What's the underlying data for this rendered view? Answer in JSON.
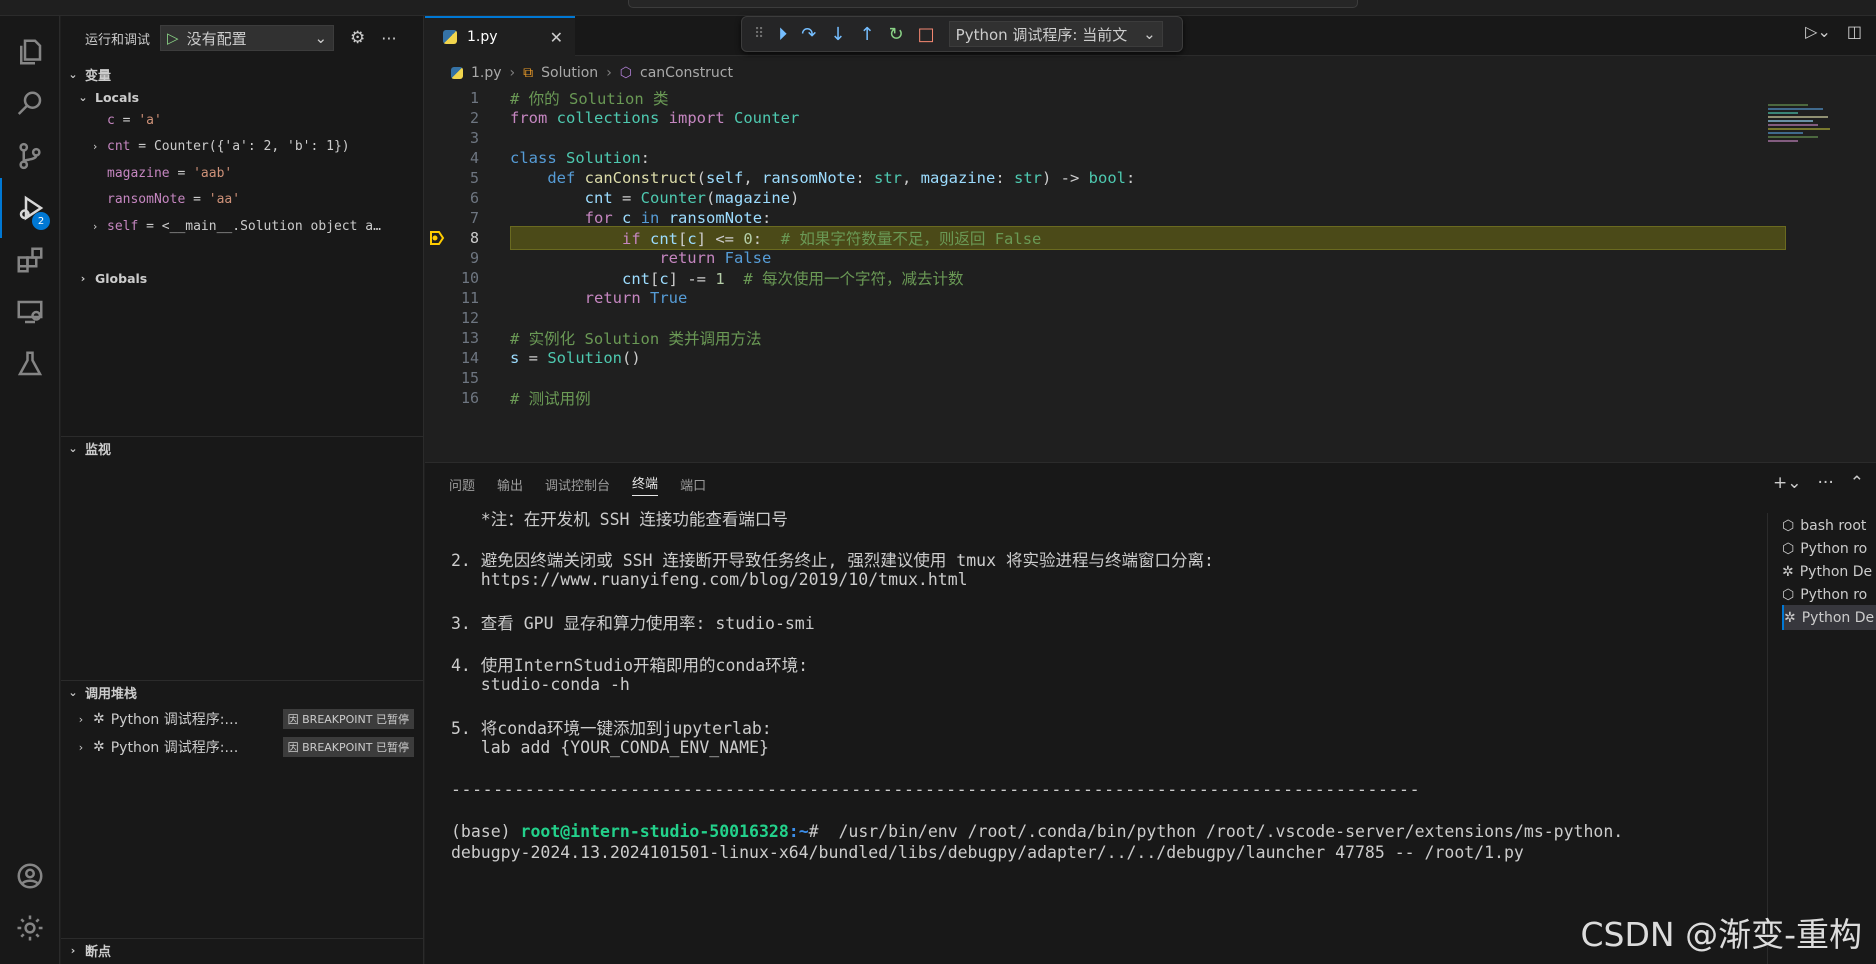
{
  "activity_bar": {
    "debug_badge": "2",
    "icons": [
      "files-icon",
      "search-icon",
      "source-control-icon",
      "run-debug-icon",
      "extensions-icon",
      "remote-explorer-icon",
      "testing-icon",
      "account-icon",
      "settings-gear-icon"
    ]
  },
  "sidebar": {
    "run_debug_label": "运行和调试",
    "config_value": "没有配置",
    "variables_title": "变量",
    "locals_title": "Locals",
    "locals": [
      {
        "name": "c",
        "value": "'a'",
        "expandable": false
      },
      {
        "name": "cnt",
        "value": "Counter({'a': 2, 'b': 1})",
        "expandable": true
      },
      {
        "name": "magazine",
        "value": "'aab'",
        "expandable": false
      },
      {
        "name": "ransomNote",
        "value": "'aa'",
        "expandable": false
      },
      {
        "name": "self",
        "value": "<__main__.Solution object a…",
        "expandable": true
      }
    ],
    "globals_title": "Globals",
    "watch_title": "监视",
    "callstack_title": "调用堆栈",
    "callstack": [
      {
        "label": "Python 调试程序:…",
        "tag": "因 BREAKPOINT 已暂停"
      },
      {
        "label": "Python 调试程序:…",
        "tag": "因 BREAKPOINT 已暂停"
      }
    ],
    "breakpoints_title": "断点"
  },
  "editor": {
    "tab_label": "1.py",
    "debug_config_label": "Python 调试程序: 当前文",
    "breadcrumb": [
      "1.py",
      "Solution",
      "canConstruct"
    ],
    "current_line": 8,
    "lines": [
      {
        "n": "1",
        "text": "# 你的 Solution 类"
      },
      {
        "n": "2",
        "text": "from collections import Counter"
      },
      {
        "n": "3",
        "text": ""
      },
      {
        "n": "4",
        "text": "class Solution:"
      },
      {
        "n": "5",
        "text": "    def canConstruct(self, ransomNote: str, magazine: str) -> bool:"
      },
      {
        "n": "6",
        "text": "        cnt = Counter(magazine)"
      },
      {
        "n": "7",
        "text": "        for c in ransomNote:"
      },
      {
        "n": "8",
        "text": "            if cnt[c] <= 0:  # 如果字符数量不足，则返回 False"
      },
      {
        "n": "9",
        "text": "                return False"
      },
      {
        "n": "10",
        "text": "            cnt[c] -= 1  # 每次使用一个字符，减去计数"
      },
      {
        "n": "11",
        "text": "        return True"
      },
      {
        "n": "12",
        "text": ""
      },
      {
        "n": "13",
        "text": "# 实例化 Solution 类并调用方法"
      },
      {
        "n": "14",
        "text": "s = Solution()"
      },
      {
        "n": "15",
        "text": ""
      },
      {
        "n": "16",
        "text": "# 测试用例"
      }
    ]
  },
  "panel": {
    "tabs": [
      "问题",
      "输出",
      "调试控制台",
      "终端",
      "端口"
    ],
    "active_tab": "终端",
    "terminal_lines": [
      "   *注：在开发机 SSH 连接功能查看端口号",
      "",
      "2. 避免因终端关闭或 SSH 连接断开导致任务终止, 强烈建议使用 tmux 将实验进程与终端窗口分离:",
      "   https://www.ruanyifeng.com/blog/2019/10/tmux.html",
      "",
      "3. 查看 GPU 显存和算力使用率: studio-smi",
      "",
      "4. 使用InternStudio开箱即用的conda环境:",
      "   studio-conda -h",
      "",
      "5. 将conda环境一键添加到jupyterlab:",
      "   lab add {YOUR_CONDA_ENV_NAME}",
      "",
      "--------------------------------------------------------------------------------------------"
    ],
    "prompt": {
      "base": "(base) ",
      "user_host": "root@intern-studio-50016328",
      "path": ":~",
      "symbol": "# ",
      "command": " /usr/bin/env /root/.conda/bin/python /root/.vscode-server/extensions/ms-python.",
      "continuation": "debugpy-2024.13.2024101501-linux-x64/bundled/libs/debugpy/adapter/../../debugpy/launcher 47785 -- /root/1.py"
    },
    "terminal_list": [
      {
        "label": "bash root",
        "icon": "terminal-icon"
      },
      {
        "label": "Python ro",
        "icon": "terminal-icon"
      },
      {
        "label": "Python De",
        "icon": "debug-icon"
      },
      {
        "label": "Python ro",
        "icon": "terminal-icon"
      },
      {
        "label": "Python De",
        "icon": "debug-icon"
      }
    ]
  },
  "watermark": "CSDN @渐变-重构"
}
